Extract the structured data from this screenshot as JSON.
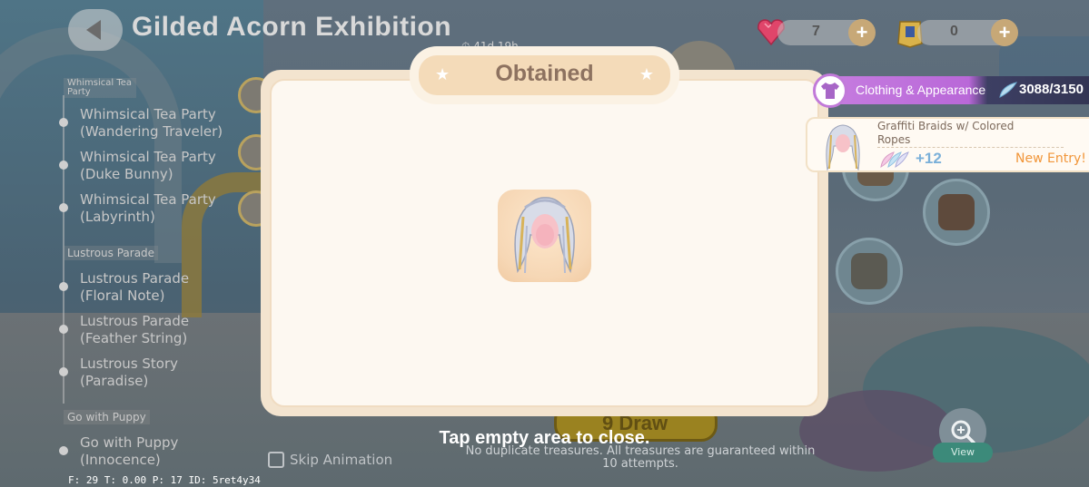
{
  "header": {
    "back_label": "",
    "title": "Gilded Acorn Exhibition",
    "timer": "41d 19h",
    "currency": {
      "gems": "7",
      "tickets": "0"
    }
  },
  "sidebar": {
    "sections": [
      {
        "header": "Whimsical Tea Party",
        "items": [
          "Whimsical Tea Party (Wandering Traveler)",
          "Whimsical Tea Party (Duke Bunny)",
          "Whimsical Tea Party (Labyrinth)"
        ]
      },
      {
        "header": "Lustrous Parade",
        "items": [
          "Lustrous Parade (Floral Note)",
          "Lustrous Parade (Feather String)",
          "Lustrous Story (Paradise)"
        ]
      },
      {
        "header": "Go with Puppy",
        "items": [
          "Go with Puppy (Innocence)"
        ]
      }
    ]
  },
  "modal": {
    "title": "Obtained",
    "item_icon": "graffiti-braids-hair-icon"
  },
  "collection": {
    "category": "Clothing & Appearance",
    "count": "3088/3150",
    "entry": {
      "name": "Graffiti Braids w/ Colored Ropes",
      "points": "+12",
      "badge": "New Entry!"
    }
  },
  "footer": {
    "tap_close": "Tap empty area to close.",
    "no_duplicate": "No duplicate treasures. All treasures are guaranteed within 10 attempts.",
    "skip_animation": "Skip Animation",
    "view": "View",
    "draw": "9 Draw",
    "debug": "F: 29   T: 0.00   P: 17   ID: 5ret4y34"
  },
  "colors": {
    "accent_purple": "#c17ad9",
    "modal_bg": "#fdf8f1",
    "new_entry": "#f1963a",
    "points": "#7bb0d9"
  }
}
